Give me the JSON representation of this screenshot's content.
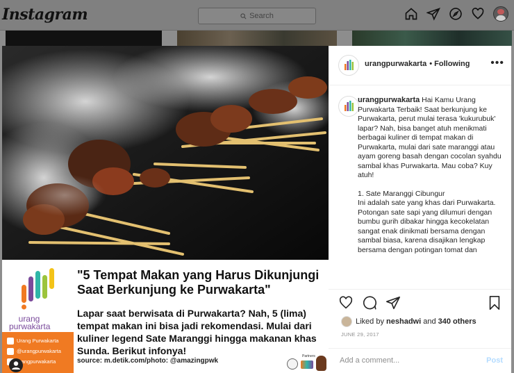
{
  "app": {
    "name": "Instagram"
  },
  "search": {
    "placeholder": "Search"
  },
  "nav": {
    "icons": [
      "home-icon",
      "direct-icon",
      "explore-icon",
      "activity-icon",
      "profile-avatar"
    ]
  },
  "post": {
    "username": "urangpurwakarta",
    "follow_status": "• Following",
    "more": "•••",
    "image": {
      "brand_line1": "urang",
      "brand_line2": "purwakarta",
      "headline": "\"5 Tempat Makan yang Harus Dikunjungi Saat Berkunjung ke Purwakarta\"",
      "subtext": "Lapar saat berwisata di Purwakarta? Nah, 5 (lima) tempat makan ini bisa jadi rekomendasi. Mulai dari kuliner legend Sate Maranggi hingga makanan khas Sunda. Berikut infonya!",
      "source": "source: m.detik.com/photo: @amazingpwk",
      "social": [
        {
          "icon": "facebook-icon",
          "label": "Urang Purwakarta"
        },
        {
          "icon": "instagram-icon",
          "label": "@urangpurwakarta"
        },
        {
          "icon": "twitter-icon",
          "label": "urangpurwakarta"
        }
      ],
      "partners_label": "Partners"
    },
    "caption": {
      "username": "urangpurwakarta",
      "text_p1": "Hai Kamu Urang Purwakarta Terbaik! Saat berkunjung ke Purwakarta, perut mulai terasa 'kukurubuk' lapar? Nah, bisa banget atuh menikmati berbagai kuliner di tempat makan di Purwakarta, mulai dari sate maranggi atau ayam goreng basah dengan cocolan syahdu sambal khas Purwakarta. Mau coba? Kuy atuh!",
      "text_p2": "1. Sate Maranggi Cibungur",
      "text_p3": "Ini adalah sate yang khas dari Purwakarta. Potongan sate sapi yang dilumuri dengan bumbu gurih dibakar hingga kecokelatan sangat enak dinikmati bersama dengan sambal biasa, karena disajikan lengkap bersama dengan potingan tomat dan"
    },
    "likes": {
      "prefix": "Liked by ",
      "user": "neshadwi",
      "middle": " and ",
      "count": "340 others"
    },
    "date": "JUNE 29, 2017",
    "add_comment": {
      "placeholder": "Add a comment...",
      "post_label": "Post"
    }
  },
  "colors": {
    "brand_orange": "#f07a22",
    "overlay_bg": "#8d8d8d",
    "post_button": "#b3dbff"
  }
}
